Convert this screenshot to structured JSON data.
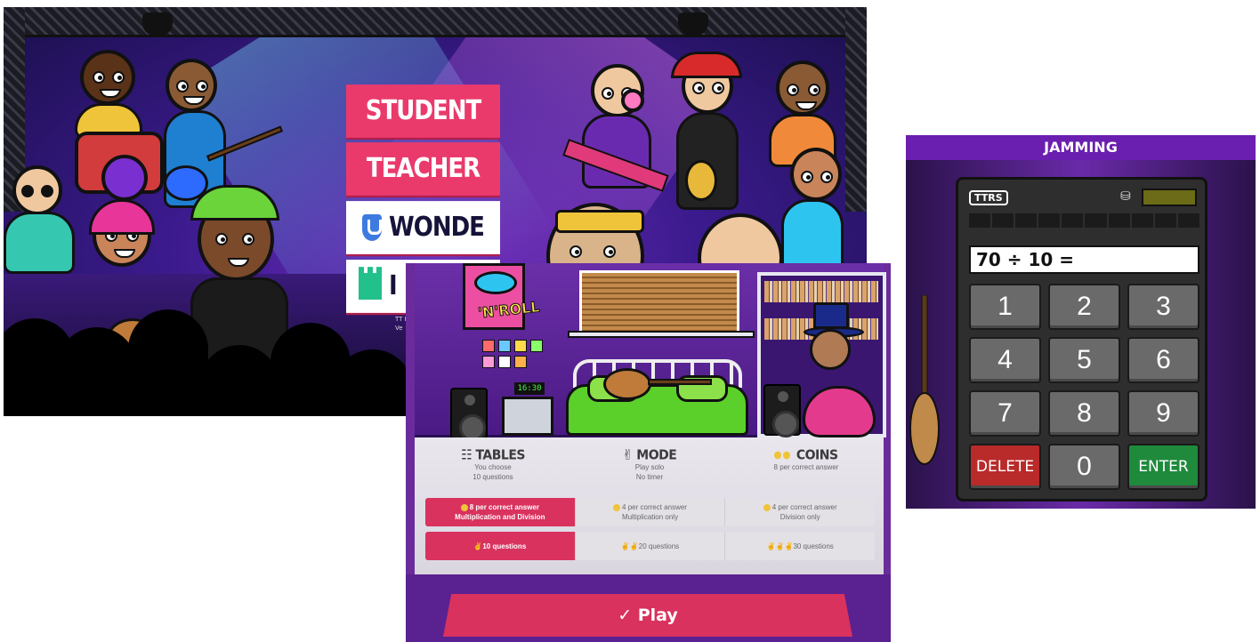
{
  "login": {
    "student_label": "STUDENT",
    "teacher_label": "TEACHER",
    "wonde_label": "WONDE",
    "fourth_label": "I",
    "small_text_1": "TT R",
    "small_text_2": "Ve"
  },
  "setup": {
    "room_poster_text": "'N'ROLL",
    "clock_text": "16:30",
    "info": [
      {
        "title": "TABLES",
        "lines": [
          "You choose",
          "10 questions"
        ]
      },
      {
        "title": "MODE",
        "lines": [
          "Play solo",
          "No timer"
        ]
      },
      {
        "title": "COINS",
        "lines": [
          "8 per correct answer"
        ]
      }
    ],
    "type_options": [
      {
        "line1": "8 per correct answer",
        "line2": "Multiplication and Division",
        "active": true
      },
      {
        "line1": "4 per correct answer",
        "line2": "Multiplication only",
        "active": false
      },
      {
        "line1": "4 per correct answer",
        "line2": "Division only",
        "active": false
      }
    ],
    "count_options": [
      {
        "label": "10 questions",
        "active": true
      },
      {
        "label": "20 questions",
        "active": false
      },
      {
        "label": "30 questions",
        "active": false
      }
    ],
    "play_label": "Play"
  },
  "keypad": {
    "title": "JAMMING",
    "logo": "TTRS",
    "question": "70 ÷ 10 =",
    "keys": [
      "1",
      "2",
      "3",
      "4",
      "5",
      "6",
      "7",
      "8",
      "9",
      "DELETE",
      "0",
      "ENTER"
    ]
  },
  "colors": {
    "accent_pink": "#ea3a6c",
    "delete_red": "#b92a2a",
    "enter_green": "#1f8a3c"
  }
}
